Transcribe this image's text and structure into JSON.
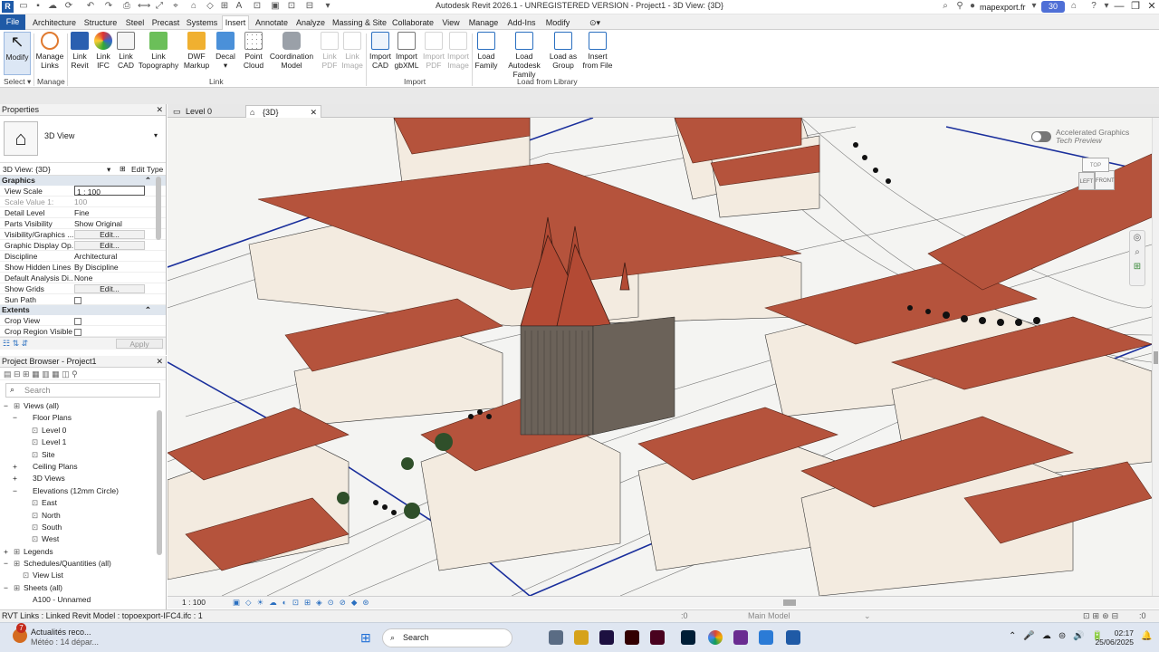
{
  "window": {
    "title": "Autodesk Revit 2026.1 - UNREGISTERED VERSION - Project1 - 3D View: {3D}",
    "user": "mapexport.fr",
    "badge": "30"
  },
  "tabs": [
    "File",
    "Architecture",
    "Structure",
    "Steel",
    "Precast",
    "Systems",
    "Insert",
    "Annotate",
    "Analyze",
    "Massing & Site",
    "Collaborate",
    "View",
    "Manage",
    "Add-Ins",
    "Modify"
  ],
  "active_tab": "Insert",
  "ribbon": {
    "buttons": [
      {
        "l1": "Modify",
        "l2": ""
      },
      {
        "l1": "Manage",
        "l2": "Links"
      },
      {
        "l1": "Link",
        "l2": "Revit"
      },
      {
        "l1": "Link",
        "l2": "IFC"
      },
      {
        "l1": "Link",
        "l2": "CAD"
      },
      {
        "l1": "Link",
        "l2": "Topography"
      },
      {
        "l1": "DWF",
        "l2": "Markup"
      },
      {
        "l1": "Decal",
        "l2": ""
      },
      {
        "l1": "Point",
        "l2": "Cloud"
      },
      {
        "l1": "Coordination",
        "l2": "Model"
      },
      {
        "l1": "Link",
        "l2": "PDF"
      },
      {
        "l1": "Link",
        "l2": "Image"
      },
      {
        "l1": "Import",
        "l2": "CAD"
      },
      {
        "l1": "Import",
        "l2": "gbXML"
      },
      {
        "l1": "Import",
        "l2": "PDF"
      },
      {
        "l1": "Import",
        "l2": "Image"
      },
      {
        "l1": "Load",
        "l2": "Family"
      },
      {
        "l1": "Load Autodesk",
        "l2": "Family"
      },
      {
        "l1": "Load as",
        "l2": "Group"
      },
      {
        "l1": "Insert",
        "l2": "from File"
      }
    ],
    "groups": {
      "select": "Select",
      "manage": "Manage",
      "link": "Link",
      "import": "Import",
      "load": "Load from Library"
    }
  },
  "properties": {
    "header": "Properties",
    "type": "3D View",
    "view_selector": "3D View: {3D}",
    "edit_type": "Edit Type",
    "sections": {
      "graphics": "Graphics",
      "extents": "Extents"
    },
    "rows": [
      {
        "k": "View Scale",
        "v": "1 : 100"
      },
      {
        "k": "Scale Value    1:",
        "v": "100"
      },
      {
        "k": "Detail Level",
        "v": "Fine"
      },
      {
        "k": "Parts Visibility",
        "v": "Show Original"
      },
      {
        "k": "Visibility/Graphics ...",
        "v": "Edit..."
      },
      {
        "k": "Graphic Display Op...",
        "v": "Edit..."
      },
      {
        "k": "Discipline",
        "v": "Architectural"
      },
      {
        "k": "Show Hidden Lines",
        "v": "By Discipline"
      },
      {
        "k": "Default Analysis Di...",
        "v": "None"
      },
      {
        "k": "Show Grids",
        "v": "Edit..."
      },
      {
        "k": "Sun Path",
        "v": ""
      }
    ],
    "extents_rows": [
      {
        "k": "Crop View",
        "v": ""
      },
      {
        "k": "Crop Region Visible",
        "v": ""
      }
    ],
    "apply": "Apply"
  },
  "browser": {
    "header": "Project Browser - Project1",
    "search_placeholder": "Search",
    "items": [
      {
        "t": "Views (all)",
        "d": 0,
        "e": "−"
      },
      {
        "t": "Floor Plans",
        "d": 1,
        "e": "−"
      },
      {
        "t": "Level 0",
        "d": 2,
        "e": ""
      },
      {
        "t": "Level 1",
        "d": 2,
        "e": ""
      },
      {
        "t": "Site",
        "d": 2,
        "e": ""
      },
      {
        "t": "Ceiling Plans",
        "d": 1,
        "e": "+"
      },
      {
        "t": "3D Views",
        "d": 1,
        "e": "+"
      },
      {
        "t": "Elevations (12mm Circle)",
        "d": 1,
        "e": "−"
      },
      {
        "t": "East",
        "d": 2,
        "e": ""
      },
      {
        "t": "North",
        "d": 2,
        "e": ""
      },
      {
        "t": "South",
        "d": 2,
        "e": ""
      },
      {
        "t": "West",
        "d": 2,
        "e": ""
      },
      {
        "t": "Legends",
        "d": 0,
        "e": "+"
      },
      {
        "t": "Schedules/Quantities (all)",
        "d": 0,
        "e": "−"
      },
      {
        "t": "View List",
        "d": 1,
        "e": ""
      },
      {
        "t": "Sheets (all)",
        "d": 0,
        "e": "−"
      },
      {
        "t": "A100 - Unnamed",
        "d": 1,
        "e": ""
      }
    ]
  },
  "view_tabs": [
    {
      "label": "Level 0"
    },
    {
      "label": "{3D}"
    }
  ],
  "canvas": {
    "graphics_line1": "Accelerated Graphics",
    "graphics_line2": "Tech Preview",
    "cube_left": "LEFT",
    "cube_front": "FRONT",
    "cube_top": "TOP"
  },
  "viewbar": {
    "scale": "1 : 100"
  },
  "status": {
    "text": "RVT Links : Linked Revit Model : topoexport-IFC4.ifc : 1",
    "workset": ":0",
    "model": "Main Model",
    "sel": ":0"
  },
  "taskbar": {
    "news": "Actualités reco...",
    "weather": "Météo : 14 dépar...",
    "news_badge": "7",
    "search": "Search",
    "time": "02:17",
    "date": "25/06/2025"
  }
}
